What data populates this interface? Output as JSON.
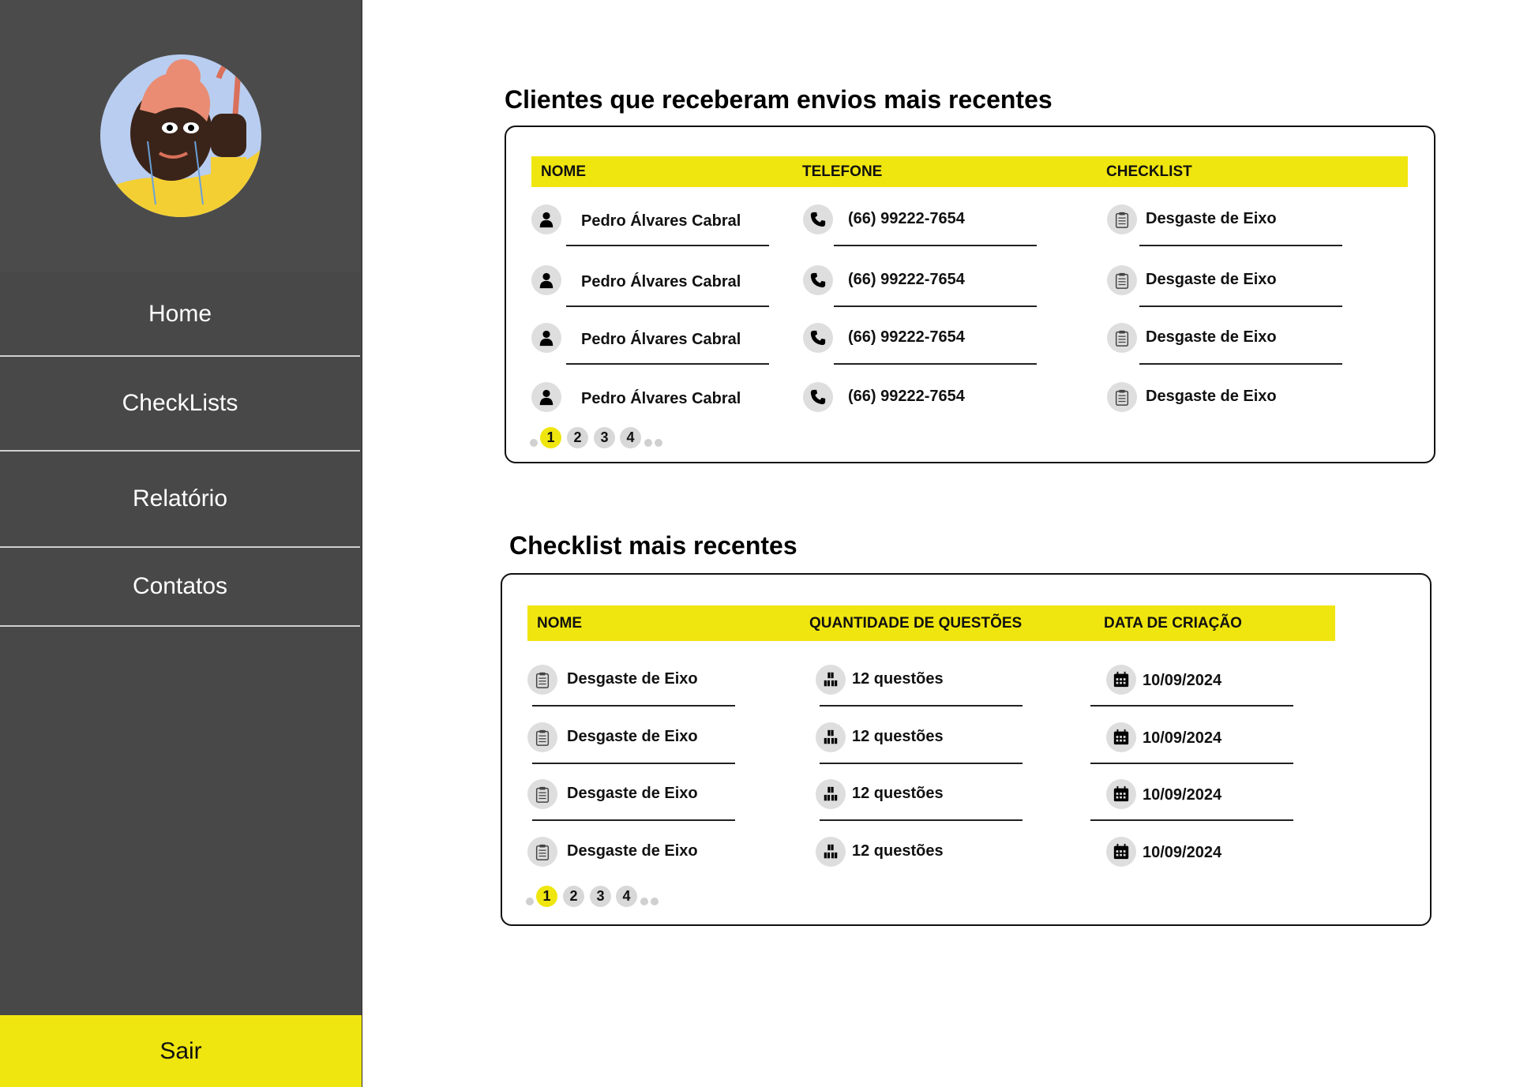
{
  "sidebar": {
    "nav": [
      "Home",
      "CheckLists",
      "Relatório",
      "Contatos"
    ],
    "logout": "Sair"
  },
  "clients": {
    "title": "Clientes que receberam envios mais recentes",
    "headers": [
      "NOME",
      "TELEFONE",
      "CHECKLIST"
    ],
    "rows": [
      {
        "name": "Pedro Álvares Cabral",
        "phone": "(66) 99222-7654",
        "checklist": "Desgaste de Eixo"
      },
      {
        "name": "Pedro Álvares Cabral",
        "phone": "(66) 99222-7654",
        "checklist": "Desgaste de Eixo"
      },
      {
        "name": "Pedro Álvares Cabral",
        "phone": "(66) 99222-7654",
        "checklist": "Desgaste de Eixo"
      },
      {
        "name": "Pedro Álvares Cabral",
        "phone": "(66) 99222-7654",
        "checklist": "Desgaste de Eixo"
      }
    ],
    "pages": [
      "1",
      "2",
      "3",
      "4"
    ],
    "active_page": "1"
  },
  "checklists": {
    "title": "Checklist mais recentes",
    "headers": [
      "NOME",
      "QUANTIDADE DE QUESTÕES",
      "DATA DE CRIAÇÃO"
    ],
    "rows": [
      {
        "name": "Desgaste de Eixo",
        "questions": "12 questões",
        "date": "10/09/2024"
      },
      {
        "name": "Desgaste de Eixo",
        "questions": "12 questões",
        "date": "10/09/2024"
      },
      {
        "name": "Desgaste de Eixo",
        "questions": "12 questões",
        "date": "10/09/2024"
      },
      {
        "name": "Desgaste de Eixo",
        "questions": "12 questões",
        "date": "10/09/2024"
      }
    ],
    "pages": [
      "1",
      "2",
      "3",
      "4"
    ],
    "active_page": "1"
  },
  "colors": {
    "accent": "#f0e60f",
    "sidebar": "#484848"
  },
  "icons": [
    "person-icon",
    "phone-icon",
    "clipboard-icon",
    "boxes-icon",
    "calendar-icon"
  ]
}
